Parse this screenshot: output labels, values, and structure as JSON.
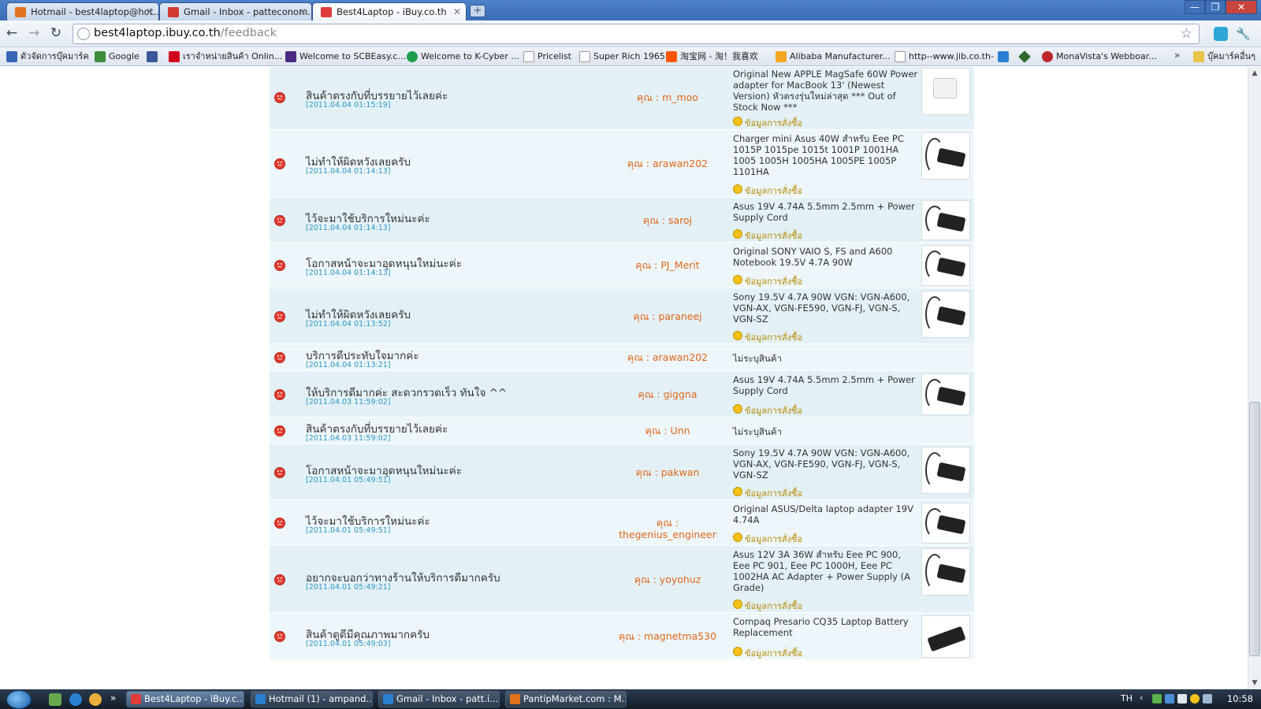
{
  "tabs": [
    {
      "label": "Hotmail - best4laptop@hot...",
      "icon": "hotmail-icon",
      "color": "#e2731e"
    },
    {
      "label": "Gmail - Inbox - patteconom...",
      "icon": "gmail-icon",
      "color": "#d23c30"
    },
    {
      "label": "Best4Laptop - iBuy.co.th",
      "icon": "ibuy-icon",
      "color": "#e03b3b"
    }
  ],
  "new_tab": "+",
  "window_controls": {
    "minimize": "—",
    "restore": "❐",
    "close": "✕"
  },
  "nav": {
    "back": "←",
    "forward": "→",
    "reload": "↻"
  },
  "url": {
    "host": "best4laptop.ibuy.co.th",
    "path": "/feedback"
  },
  "bookmarks": [
    {
      "label": "ตัวจัดการบุ๊คมาร์ค",
      "color": "#3a66b8"
    },
    {
      "label": "Google",
      "color": "#3c8e3c"
    },
    {
      "label": "",
      "color": "#3b5998"
    },
    {
      "label": "เราจำหน่ายสินค้า Onlin...",
      "color": "#d0021b"
    },
    {
      "label": "Welcome to SCBEasy.c...",
      "color": "#4b2a82"
    },
    {
      "label": "Welcome to K-Cyber ...",
      "color": "#1c9d4a"
    },
    {
      "label": "Pricelist",
      "color": "#cfd5dc"
    },
    {
      "label": "Super Rich 1965",
      "color": "#cfd5dc"
    },
    {
      "label": "淘宝网 - 淘！我喜欢",
      "color": "#ff5500"
    },
    {
      "label": "Alibaba Manufacturer...",
      "color": "#f5a623"
    },
    {
      "label": "http--www.jib.co.th-",
      "color": "#cfd5dc"
    },
    {
      "label": "",
      "color": "#2a7fd0"
    },
    {
      "label": "",
      "color": "#2e6a2e"
    },
    {
      "label": "MonaVista's Webboar...",
      "color": "#c0272d"
    }
  ],
  "bookmarks_more": "»",
  "other_bookmarks": "บุ๊คมาร์คอื่นๆ",
  "order_info_label": "ข้อมูลการสั่งซื้อ",
  "feedback": [
    {
      "comment": "สินค้าตรงกับที่บรรยายไว้เลยค่ะ",
      "date": "[2011.04.04 01:15:19]",
      "buyer": "คุณ : m_moo",
      "product": "Original New APPLE MagSafe 60W Power adapter for MacBook 13' (Newest Version) หัวตรงรุ่นใหม่ล่าสุด *** Out of Stock Now ***",
      "thumb": "white-adapter"
    },
    {
      "comment": "ไม่ทำให้ผิดหวังเลยครับ",
      "date": "[2011.04.04 01:14:13]",
      "buyer": "คุณ : arawan202",
      "product": "Charger mini Asus 40W สำหรับ Eee PC 1015P 1015pe 1015t 1001P 1001HA 1005 1005H 1005HA 1005PE 1005P 1101HA",
      "thumb": "black-adapter"
    },
    {
      "comment": "ไว้จะมาใช้บริการใหม่นะค่ะ",
      "date": "[2011.04.04 01:14:13]",
      "buyer": "คุณ : saroj",
      "product": "Asus 19V 4.74A 5.5mm 2.5mm + Power Supply Cord",
      "thumb": "black-adapter"
    },
    {
      "comment": "โอกาสหน้าจะมาอุดหนุนใหม่นะค่ะ",
      "date": "[2011.04.04 01:14:13]",
      "buyer": "คุณ : PJ_Merit",
      "product": "Original SONY VAIO S, FS and A600 Notebook 19.5V 4.7A 90W",
      "thumb": "black-adapter"
    },
    {
      "comment": "ไม่ทำให้ผิดหวังเลยครับ",
      "date": "[2011.04.04 01:13:52]",
      "buyer": "คุณ : paraneej",
      "product": "Sony 19.5V 4.7A 90W VGN: VGN-A600, VGN-AX, VGN-FE590, VGN-FJ, VGN-S, VGN-SZ",
      "thumb": "black-adapter"
    },
    {
      "comment": "บริการดีประทับใจมากค่ะ",
      "date": "[2011.04.04 01:13:21]",
      "buyer": "คุณ : arawan202",
      "product": "",
      "no_product": "ไม่ระบุสินค้า",
      "thumb": ""
    },
    {
      "comment": "ให้บริการดีมากค่ะ สะดวกรวดเร็ว ทันใจ ^^",
      "date": "[2011.04.03 11:59:02]",
      "buyer": "คุณ : giggna",
      "product": "Asus 19V 4.74A 5.5mm 2.5mm + Power Supply Cord",
      "thumb": "black-adapter"
    },
    {
      "comment": "สินค้าตรงกับที่บรรยายไว้เลยค่ะ",
      "date": "[2011.04.03 11:59:02]",
      "buyer": "คุณ : Unn",
      "product": "",
      "no_product": "ไม่ระบุสินค้า",
      "thumb": ""
    },
    {
      "comment": "โอกาสหน้าจะมาอุดหนุนใหม่นะค่ะ",
      "date": "[2011.04.01 05:49:51]",
      "buyer": "คุณ : pakwan",
      "product": "Sony 19.5V 4.7A 90W VGN: VGN-A600, VGN-AX, VGN-FE590, VGN-FJ, VGN-S, VGN-SZ",
      "thumb": "black-adapter"
    },
    {
      "comment": "ไว้จะมาใช้บริการใหม่นะค่ะ",
      "date": "[2011.04.01 05:49:51]",
      "buyer": "คุณ : thegenius_engineer",
      "product": "Original ASUS/Delta laptop adapter 19V 4.74A",
      "thumb": "black-adapter"
    },
    {
      "comment": "อยากจะบอกว่าทางร้านให้บริการดีมากครับ",
      "date": "[2011.04.01 05:49:21]",
      "buyer": "คุณ : yoyohuz",
      "product": "Asus 12V 3A 36W สำหรับ Eee PC 900, Eee PC 901, Eee PC 1000H, Eee PC 1002HA AC Adapter + Power Supply (A Grade)",
      "thumb": "black-adapter"
    },
    {
      "comment": "สินค้าดูดีมีคุณภาพมากครับ",
      "date": "[2011.04.01 05:49:03]",
      "buyer": "คุณ : magnetma530",
      "product": "Compaq Presario CQ35 Laptop Battery Replacement",
      "thumb": "battery"
    }
  ],
  "scrollbar": {
    "up": "▲",
    "down": "▼"
  },
  "taskbar": {
    "tasks": [
      {
        "label": "Best4Laptop - iBuy.c...",
        "color": "#e03b3b"
      },
      {
        "label": "Hotmail (1) - ampand...",
        "color": "#2a7fd0"
      },
      {
        "label": "Gmail - Inbox - patt.i...",
        "color": "#2a7fd0"
      },
      {
        "label": "PantipMarket.com : M...",
        "color": "#e2731e"
      }
    ],
    "tray_lang": "TH",
    "clock": "10:58"
  }
}
